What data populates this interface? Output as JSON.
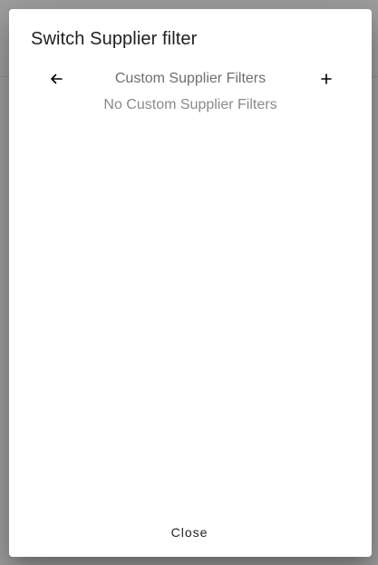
{
  "dialog": {
    "title": "Switch Supplier filter",
    "nav": {
      "back_icon": "arrow-left-icon",
      "title": "Custom Supplier Filters",
      "add_icon": "plus-icon"
    },
    "empty_message": "No Custom Supplier Filters",
    "close_label": "Close"
  }
}
